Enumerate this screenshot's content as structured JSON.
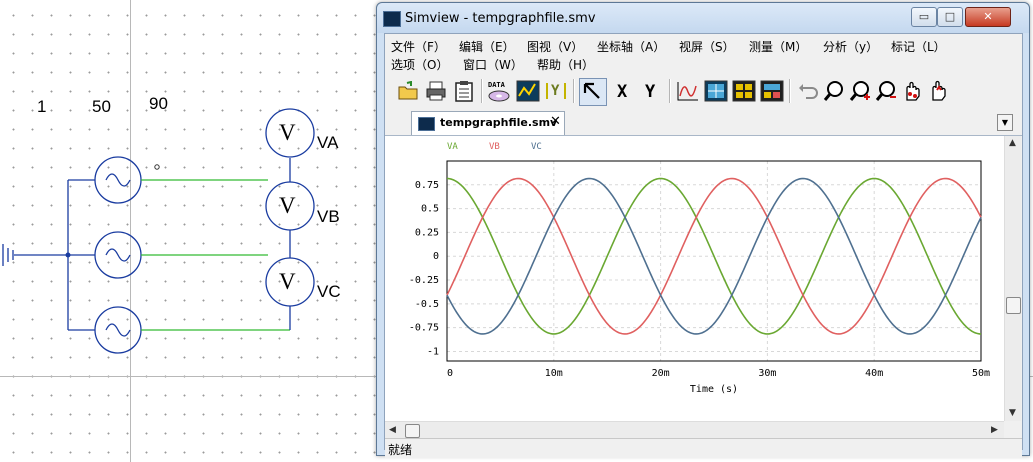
{
  "schematic": {
    "params": [
      "1",
      "50",
      "90"
    ],
    "meters": [
      {
        "symbol": "V",
        "label": "VA"
      },
      {
        "symbol": "V",
        "label": "VB"
      },
      {
        "symbol": "V",
        "label": "VC"
      }
    ]
  },
  "window": {
    "title": "Simview - tempgraphfile.smv",
    "controls": {
      "minimize": "▭",
      "maximize": "□",
      "close": "✕"
    }
  },
  "menu": [
    "文件（F）",
    "编辑（E）",
    "图视（V）",
    "坐标轴（A）",
    "视屏（S）",
    "测量（M）",
    "分析（y）",
    "标记（L）",
    "选项（O）",
    "窗口（W）",
    "帮助（H）"
  ],
  "toolbar": {
    "data_label": "DATA",
    "x_label": "X",
    "y_label": "Y",
    "icons": [
      "open-folder-icon",
      "print-icon",
      "clipboard-icon",
      "data-icon",
      "chart-icon",
      "y-axis-icon",
      "pointer-icon",
      "x-axis-icon",
      "y-axis-button-icon",
      "waveform-icon",
      "grid-view-icon",
      "layout-icon",
      "screen-icon",
      "undo-icon",
      "zoom-icon",
      "zoom-in-icon",
      "zoom-out-icon",
      "pan-hand-icon",
      "pan-hand-up-icon"
    ]
  },
  "tab": {
    "label": "tempgraphfile.smv",
    "close": "✕",
    "dropdown": "▼"
  },
  "status": "就绪",
  "colors": {
    "VA": "#6aa832",
    "VB": "#e06060",
    "VC": "#4f7090",
    "wire": "#33bb33",
    "accent": "#3a7bd5"
  },
  "chart_data": {
    "type": "line",
    "x_start": 0,
    "x_end": 0.05,
    "freq_hz": 50,
    "amplitude": 0.816,
    "series": [
      {
        "name": "VA",
        "phase_deg": 90
      },
      {
        "name": "VB",
        "phase_deg": -30
      },
      {
        "name": "VC",
        "phase_deg": 210
      }
    ],
    "xlabel": "Time (s)",
    "ylabel": "",
    "xlim": [
      0,
      0.05
    ],
    "ylim": [
      -1.1,
      1.0
    ],
    "xticks": [
      0,
      0.01,
      0.02,
      0.03,
      0.04,
      0.05
    ],
    "xtick_labels": [
      "0",
      "10m",
      "20m",
      "30m",
      "40m",
      "50m"
    ],
    "yticks": [
      0.75,
      0.5,
      0.25,
      0,
      -0.25,
      -0.5,
      -0.75,
      -1
    ],
    "ytick_labels": [
      "0.75",
      "0.5",
      "0.25",
      "0",
      "-0.25",
      "-0.5",
      "-0.75",
      "-1"
    ],
    "grid": true,
    "legend": "top-left"
  }
}
